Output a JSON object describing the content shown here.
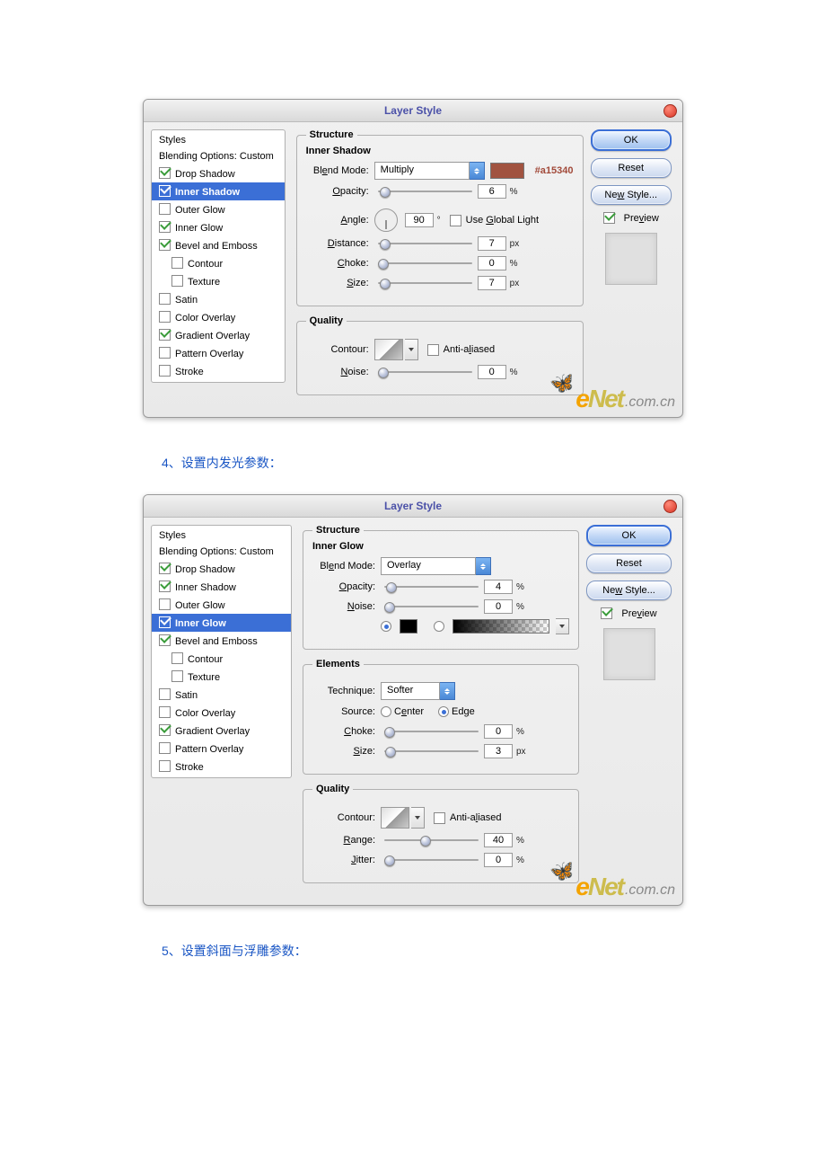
{
  "captions": {
    "c1": "4、设置内发光参数：",
    "c2": "5、设置斜面与浮雕参数："
  },
  "common": {
    "title": "Layer Style",
    "styles_header": "Styles",
    "blending_options": "Blending Options: Custom",
    "ok": "OK",
    "reset": "Reset",
    "new_style": "New Style...",
    "preview": "Preview",
    "watermark_e": "e",
    "watermark_net": "Net",
    "watermark_dom": ".com.cn",
    "styles": {
      "drop_shadow": "Drop Shadow",
      "inner_shadow": "Inner Shadow",
      "outer_glow": "Outer Glow",
      "inner_glow": "Inner Glow",
      "bevel_emboss": "Bevel and Emboss",
      "contour": "Contour",
      "texture": "Texture",
      "satin": "Satin",
      "color_overlay": "Color Overlay",
      "gradient_overlay": "Gradient Overlay",
      "pattern_overlay": "Pattern Overlay",
      "stroke": "Stroke"
    },
    "labels": {
      "blend_mode": "Blend Mode:",
      "opacity": "Opacity:",
      "angle": "Angle:",
      "use_global": "Use Global Light",
      "distance": "Distance:",
      "choke": "Choke:",
      "size": "Size:",
      "contour": "Contour:",
      "anti_aliased": "Anti-aliased",
      "noise": "Noise:",
      "technique": "Technique:",
      "source": "Source:",
      "center": "Center",
      "edge": "Edge",
      "range": "Range:",
      "jitter": "Jitter:"
    },
    "groups": {
      "structure": "Structure",
      "quality": "Quality",
      "elements": "Elements"
    },
    "units": {
      "pct": "%",
      "px": "px",
      "deg": "°"
    }
  },
  "d1": {
    "heading": "Inner Shadow",
    "blend_mode": "Multiply",
    "color_hex": "#a15340",
    "opacity": "6",
    "angle": "90",
    "distance": "7",
    "choke": "0",
    "size": "7",
    "noise": "0"
  },
  "d2": {
    "heading": "Inner Glow",
    "blend_mode": "Overlay",
    "opacity": "4",
    "noise": "0",
    "technique": "Softer",
    "choke": "0",
    "size": "3",
    "range": "40",
    "jitter": "0"
  }
}
